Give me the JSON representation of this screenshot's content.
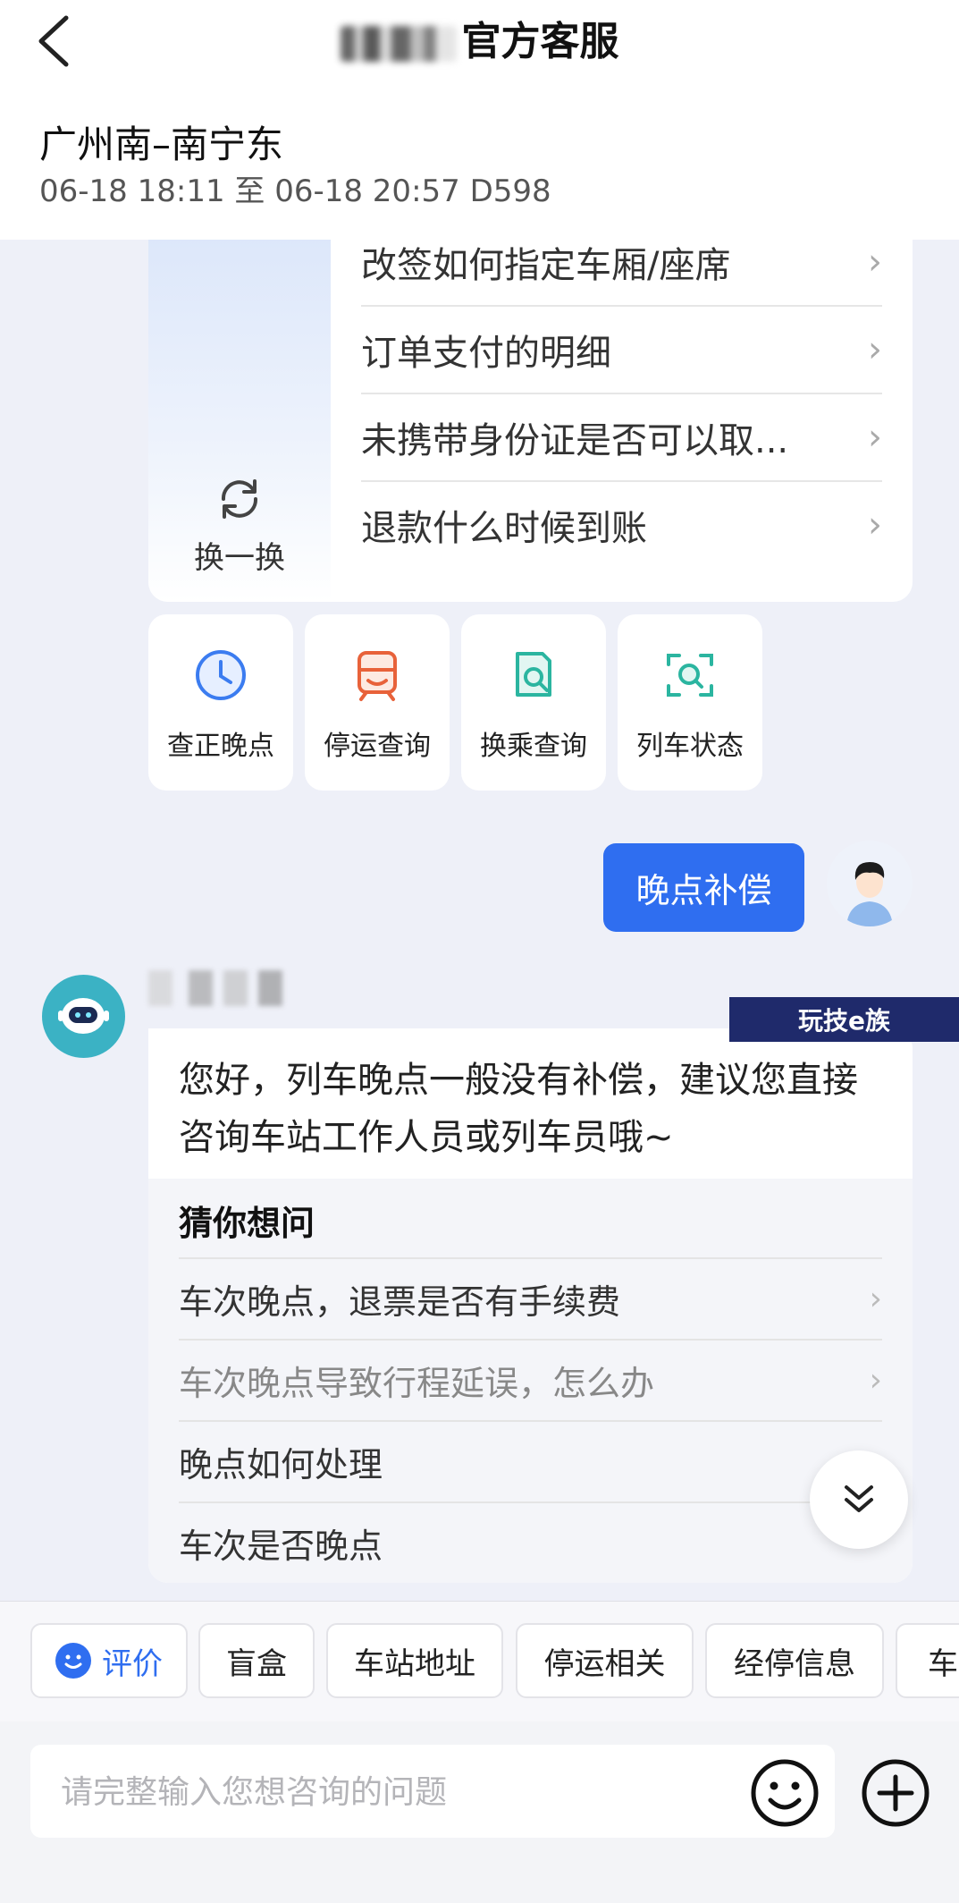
{
  "header": {
    "title": "官方客服",
    "route": "广州南–南宁东",
    "trip_info": "06-18 18:11 至 06-18 20:57 D598"
  },
  "question_card": {
    "refresh_label": "换一换",
    "items": [
      "改签如何指定车厢/座席",
      "订单支付的明细",
      "未携带身份证是否可以取...",
      "退款什么时候到账"
    ]
  },
  "tools": [
    {
      "label": "查正晚点",
      "icon": "clock-icon",
      "color": "#3b7cf0"
    },
    {
      "label": "停运查询",
      "icon": "train-icon",
      "color": "#e8623a"
    },
    {
      "label": "换乘查询",
      "icon": "doc-search-icon",
      "color": "#2bb5a0"
    },
    {
      "label": "列车状态",
      "icon": "scan-icon",
      "color": "#2bb5a0"
    }
  ],
  "user_message": "晚点补偿",
  "watermark": "玩技e族",
  "bot": {
    "answer": "您好，列车晚点一般没有补偿，建议您直接咨询车站工作人员或列车员哦~",
    "guess_title": "猜你想问",
    "guess_items": [
      "车次晚点，退票是否有手续费",
      "车次晚点导致行程延误，怎么办",
      "晚点如何处理",
      "车次是否晚点"
    ]
  },
  "chips": [
    "评价",
    "盲盒",
    "车站地址",
    "停运相关",
    "经停信息",
    "车站"
  ],
  "input": {
    "placeholder": "请完整输入您想咨询的问题"
  },
  "colors": {
    "accent": "#2f6ef0",
    "background": "#eef0f8"
  }
}
